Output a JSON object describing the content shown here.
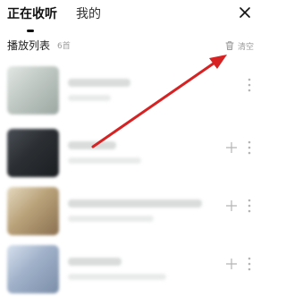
{
  "tabs": [
    {
      "label": "正在收听"
    },
    {
      "label": "我的"
    }
  ],
  "playlist": {
    "title": "播放列表",
    "count": "6首",
    "clear_label": "清空"
  },
  "items": [
    {
      "thumb_colors": [
        "#bfc8c3",
        "#e2e7e4",
        "#9ca7a2"
      ]
    },
    {
      "thumb_colors": [
        "#2b2f33",
        "#4a4f56",
        "#1b1e21"
      ]
    },
    {
      "thumb_colors": [
        "#b9a27a",
        "#e5d9bf",
        "#8b7050"
      ]
    },
    {
      "thumb_colors": [
        "#9fb0c8",
        "#d6e0ee",
        "#7b8ea9"
      ]
    }
  ],
  "colors": {
    "annotation_arrow": "#d62222",
    "muted_text": "#9b9b9b"
  }
}
